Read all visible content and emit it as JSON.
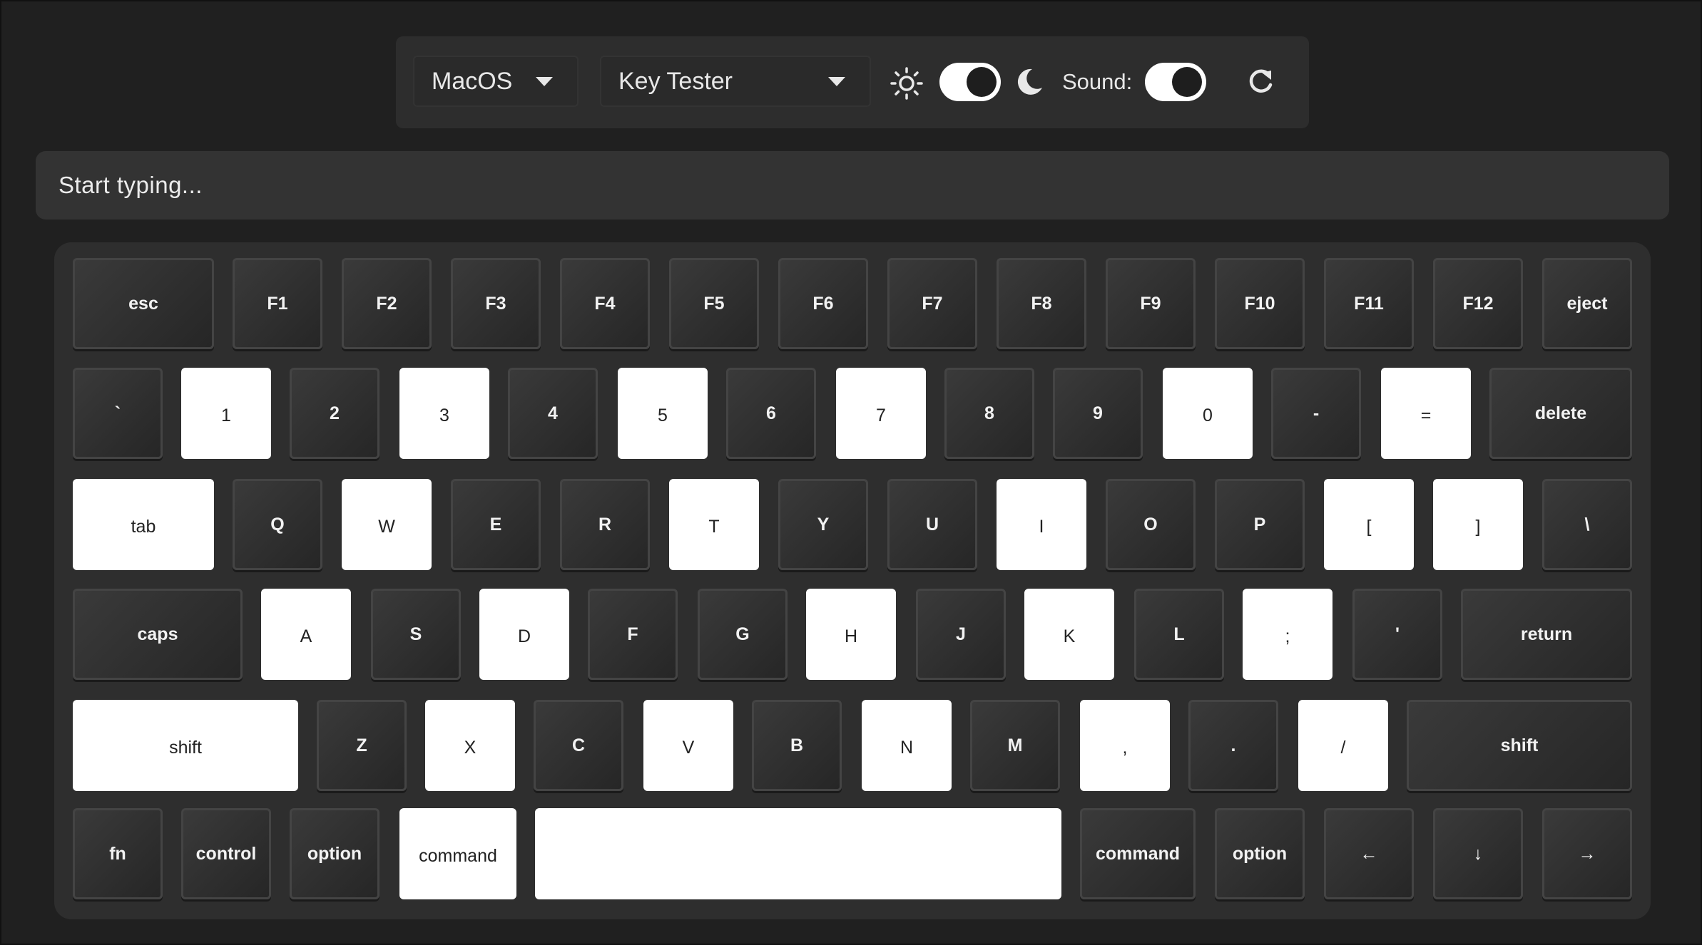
{
  "toolbar": {
    "os_select": "MacOS",
    "mode_select": "Key Tester",
    "sound_label": "Sound:",
    "theme_toggle_on": true,
    "sound_toggle_on": true
  },
  "typing": {
    "placeholder": "Start typing..."
  },
  "keyboard": {
    "rows": [
      {
        "keys": [
          {
            "label": "esc",
            "on": false
          },
          {
            "label": "F1",
            "on": false
          },
          {
            "label": "F2",
            "on": false
          },
          {
            "label": "F3",
            "on": false
          },
          {
            "label": "F4",
            "on": false
          },
          {
            "label": "F5",
            "on": false
          },
          {
            "label": "F6",
            "on": false
          },
          {
            "label": "F7",
            "on": false
          },
          {
            "label": "F8",
            "on": false
          },
          {
            "label": "F9",
            "on": false
          },
          {
            "label": "F10",
            "on": false
          },
          {
            "label": "F11",
            "on": false
          },
          {
            "label": "F12",
            "on": false
          },
          {
            "label": "eject",
            "on": false
          }
        ]
      },
      {
        "keys": [
          {
            "label": "`",
            "on": false
          },
          {
            "label": "1",
            "on": true
          },
          {
            "label": "2",
            "on": false
          },
          {
            "label": "3",
            "on": true
          },
          {
            "label": "4",
            "on": false
          },
          {
            "label": "5",
            "on": true
          },
          {
            "label": "6",
            "on": false
          },
          {
            "label": "7",
            "on": true
          },
          {
            "label": "8",
            "on": false
          },
          {
            "label": "9",
            "on": false
          },
          {
            "label": "0",
            "on": true
          },
          {
            "label": "-",
            "on": false
          },
          {
            "label": "=",
            "on": true
          },
          {
            "label": "delete",
            "on": false
          }
        ]
      },
      {
        "keys": [
          {
            "label": "tab",
            "on": true
          },
          {
            "label": "Q",
            "on": false
          },
          {
            "label": "W",
            "on": true
          },
          {
            "label": "E",
            "on": false
          },
          {
            "label": "R",
            "on": false
          },
          {
            "label": "T",
            "on": true
          },
          {
            "label": "Y",
            "on": false
          },
          {
            "label": "U",
            "on": false
          },
          {
            "label": "I",
            "on": true
          },
          {
            "label": "O",
            "on": false
          },
          {
            "label": "P",
            "on": false
          },
          {
            "label": "[",
            "on": true
          },
          {
            "label": "]",
            "on": true
          },
          {
            "label": "\\",
            "on": false
          }
        ]
      },
      {
        "keys": [
          {
            "label": "caps",
            "on": false
          },
          {
            "label": "A",
            "on": true
          },
          {
            "label": "S",
            "on": false
          },
          {
            "label": "D",
            "on": true
          },
          {
            "label": "F",
            "on": false
          },
          {
            "label": "G",
            "on": false
          },
          {
            "label": "H",
            "on": true
          },
          {
            "label": "J",
            "on": false
          },
          {
            "label": "K",
            "on": true
          },
          {
            "label": "L",
            "on": false
          },
          {
            "label": ";",
            "on": true
          },
          {
            "label": "'",
            "on": false
          },
          {
            "label": "return",
            "on": false
          }
        ]
      },
      {
        "keys": [
          {
            "label": "shift",
            "on": true
          },
          {
            "label": "Z",
            "on": false
          },
          {
            "label": "X",
            "on": true
          },
          {
            "label": "C",
            "on": false
          },
          {
            "label": "V",
            "on": true
          },
          {
            "label": "B",
            "on": false
          },
          {
            "label": "N",
            "on": true
          },
          {
            "label": "M",
            "on": false
          },
          {
            "label": ",",
            "on": true
          },
          {
            "label": ".",
            "on": false
          },
          {
            "label": "/",
            "on": true
          },
          {
            "label": "shift",
            "on": false
          }
        ]
      },
      {
        "keys": [
          {
            "label": "fn",
            "on": false
          },
          {
            "label": "control",
            "on": false
          },
          {
            "label": "option",
            "on": false
          },
          {
            "label": "command",
            "on": true
          },
          {
            "label": "",
            "on": true
          },
          {
            "label": "command",
            "on": false
          },
          {
            "label": "option",
            "on": false
          },
          {
            "label": "←",
            "on": false
          },
          {
            "label": "↓",
            "on": false
          },
          {
            "label": "→",
            "on": false
          }
        ]
      }
    ]
  }
}
